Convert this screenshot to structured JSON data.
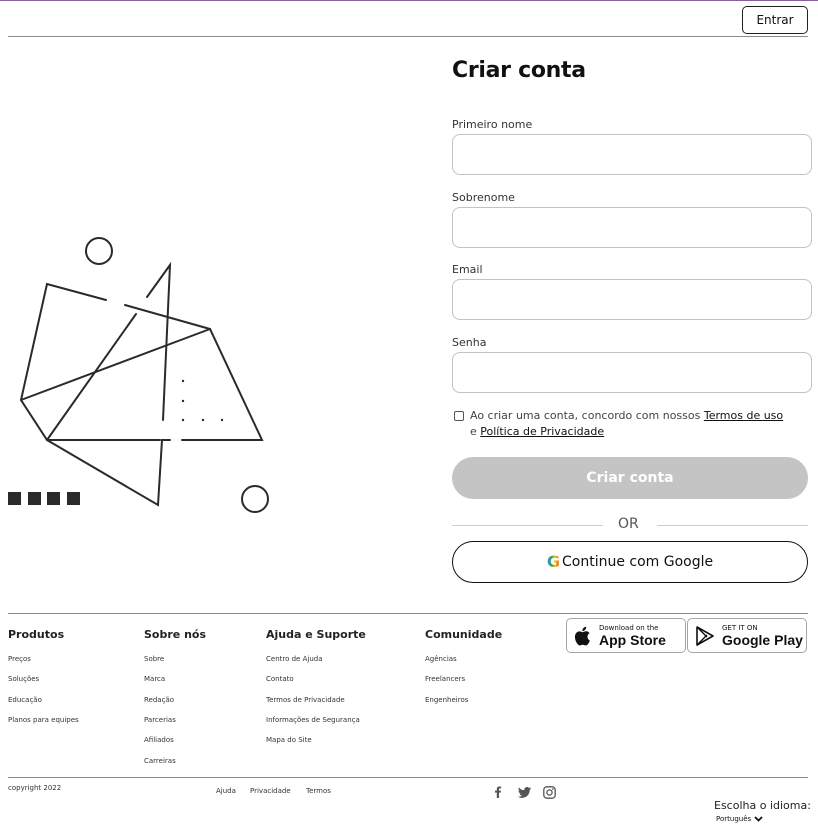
{
  "header": {
    "login_label": "Entrar"
  },
  "form": {
    "title": "Criar conta",
    "first_name": {
      "label": "Primeiro nome",
      "value": ""
    },
    "last_name": {
      "label": "Sobrenome",
      "value": ""
    },
    "email": {
      "label": "Email",
      "value": ""
    },
    "password": {
      "label": "Senha",
      "value": ""
    },
    "consent": {
      "checked": false,
      "prefix": "Ao criar uma conta, concordo com nossos ",
      "terms_link": "Termos de uso",
      "and": "e ",
      "privacy_link": "Política de Privacidade"
    },
    "submit_label": "Criar conta",
    "or_label": "OR",
    "google_label": "Continue com Google",
    "google_icon": "G"
  },
  "footer": {
    "columns": [
      {
        "title": "Produtos",
        "links": [
          "Preços",
          "Soluções",
          "Educação",
          "Planos para equipes"
        ]
      },
      {
        "title": "Sobre nós",
        "links": [
          "Sobre",
          "Marca",
          "Redação",
          "Parcerias",
          "Afiliados",
          "Carreiras"
        ]
      },
      {
        "title": "Ajuda e Suporte",
        "links": [
          "Centro de Ajuda",
          "Contato",
          "Termos de Privacidade",
          "Informações de Segurança",
          "Mapa do Site"
        ]
      },
      {
        "title": "Comunidade",
        "links": [
          "Agências",
          "Freelancers",
          "Engenheiros"
        ]
      }
    ],
    "app_store": {
      "small": "Download on the",
      "big": "App Store"
    },
    "google_play": {
      "small": "GET IT ON",
      "big": "Google Play"
    },
    "copyright": "copyright 2022",
    "bottom_links": [
      "Ajuda",
      "Privacidade",
      "Termos"
    ],
    "social_icons": [
      "facebook-icon",
      "twitter-icon",
      "instagram-icon"
    ],
    "language": {
      "label": "Escolha o idioma:",
      "selected": "Português"
    }
  },
  "colors": {
    "button_disabled": "#c4c4c4",
    "divider": "#8c8c8c",
    "top_accent": "#8a5fa0"
  }
}
